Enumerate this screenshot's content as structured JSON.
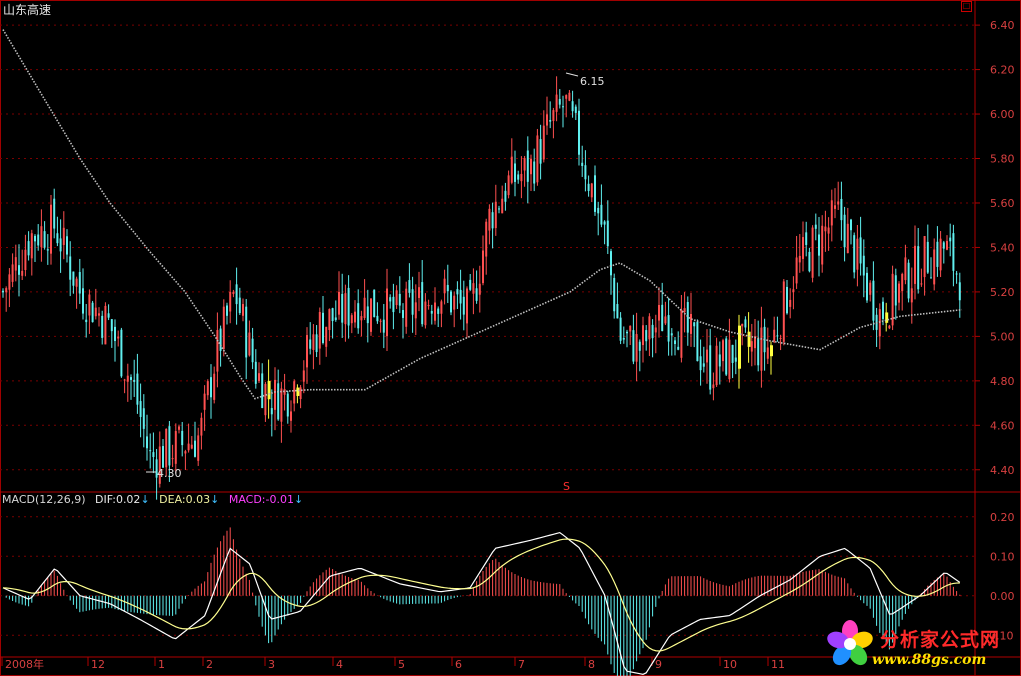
{
  "chart_data": [
    {
      "type": "candlestick",
      "title": "山东高速",
      "ylim": [
        4.3,
        6.45
      ],
      "yticks": [
        "6.40",
        "6.20",
        "6.00",
        "5.80",
        "5.60",
        "5.40",
        "5.20",
        "5.00",
        "4.80",
        "4.60",
        "4.40"
      ],
      "annotations": {
        "high_label": "6.15",
        "low_label": "4.30",
        "marker": "S"
      },
      "up_color": "#ff5050",
      "down_color": "#60f0f0",
      "highlight_color": "#ffff40",
      "moving_average_color": "#c0c0c0",
      "x_labels": [
        "2008年",
        "12",
        "1",
        "2",
        "3",
        "4",
        "5",
        "6",
        "7",
        "8",
        "9",
        "10",
        "11"
      ],
      "grid": true
    },
    {
      "type": "bar-line",
      "name": "MACD(12,26,9)",
      "dif_label": "DIF:0.02",
      "dea_label": "DEA:0.03",
      "macd_label": "MACD:-0.01",
      "arrow": "↓",
      "ylim": [
        -0.15,
        0.25
      ],
      "yticks": [
        "0.20",
        "0.10",
        "0.00",
        "-0.10"
      ],
      "dif_color": "#ffffff",
      "dea_color": "#ffff90",
      "pos_color": "#ff5050",
      "neg_color": "#60f0f0",
      "grid": true
    }
  ],
  "watermark": {
    "site": "分析家公式网",
    "url": "www.88gs.com"
  },
  "corner_icon": "restore-icon"
}
